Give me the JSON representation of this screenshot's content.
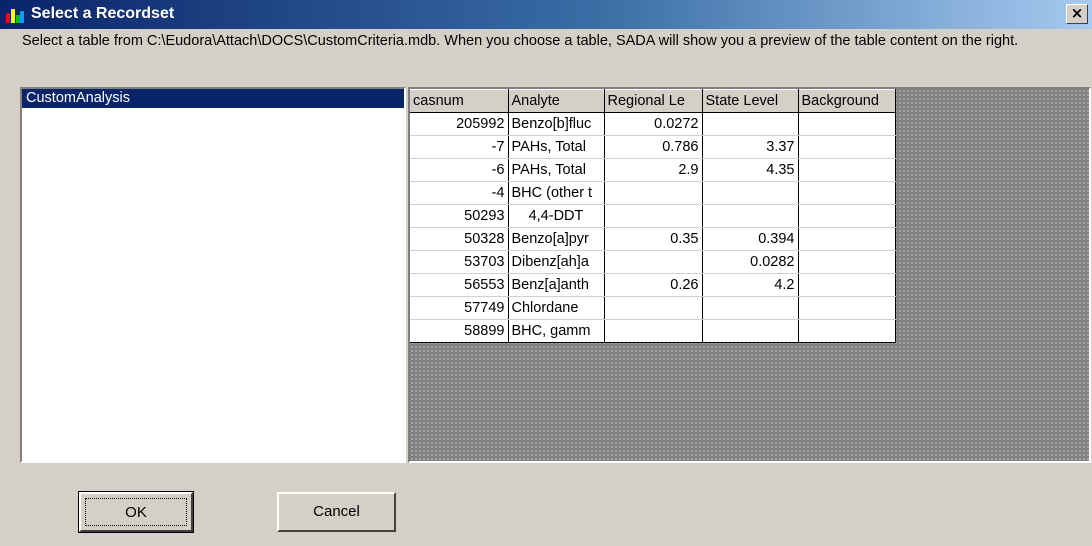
{
  "window": {
    "title": "Select a Recordset",
    "close_label": "×"
  },
  "instructions": "Select a table from C:\\Eudora\\Attach\\DOCS\\CustomCriteria.mdb.  When you choose a table, SADA will show you a preview of the table content on the right.",
  "table_list": {
    "items": [
      "CustomAnalysis"
    ],
    "selected": "CustomAnalysis"
  },
  "preview": {
    "columns": [
      "casnum",
      "Analyte",
      "Regional Le",
      "State Level",
      "Background"
    ],
    "rows": [
      [
        "205992",
        "Benzo[b]fluc",
        "0.0272",
        "",
        ""
      ],
      [
        "-7",
        "PAHs, Total",
        "0.786",
        "3.37",
        ""
      ],
      [
        "-6",
        "PAHs, Total",
        "2.9",
        "4.35",
        ""
      ],
      [
        "-4",
        "BHC (other t",
        "",
        "",
        ""
      ],
      [
        "50293",
        "4,4-DDT",
        "",
        "",
        ""
      ],
      [
        "50328",
        "Benzo[a]pyr",
        "0.35",
        "0.394",
        ""
      ],
      [
        "53703",
        "Dibenz[ah]a",
        "",
        "0.0282",
        ""
      ],
      [
        "56553",
        "Benz[a]anth",
        "0.26",
        "4.2",
        ""
      ],
      [
        "57749",
        "Chlordane",
        "",
        "",
        ""
      ],
      [
        "58899",
        "BHC, gamm",
        "",
        "",
        ""
      ]
    ]
  },
  "buttons": {
    "ok": "OK",
    "cancel": "Cancel"
  },
  "colors": {
    "title_start": "#0a246a",
    "title_end": "#a6caf0",
    "selection": "#0a246a",
    "face": "#d4d0c8"
  }
}
